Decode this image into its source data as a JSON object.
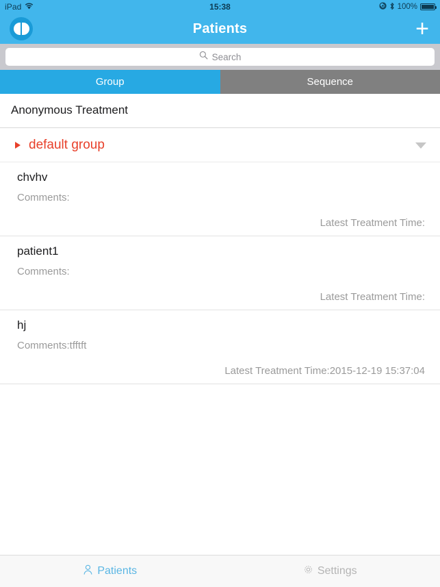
{
  "status_bar": {
    "carrier": "iPad",
    "wifi_icon": "wifi-icon",
    "time": "15:38",
    "rotation_lock_icon": "rotation-lock-icon",
    "bluetooth_icon": "bluetooth-icon",
    "battery_percent": "100%",
    "battery_icon": "battery-full-icon"
  },
  "navbar": {
    "logo_icon": "app-logo-icon",
    "title": "Patients",
    "add_label": "+",
    "add_icon": "plus-icon",
    "background_color": "#41b6ec"
  },
  "search": {
    "placeholder": "Search",
    "value": "",
    "icon": "search-icon"
  },
  "segmented": {
    "tabs": [
      {
        "label": "Group",
        "active": true,
        "color": "#27a9e3"
      },
      {
        "label": "Sequence",
        "active": false,
        "color": "#808080"
      }
    ]
  },
  "main": {
    "section_title": "Anonymous Treatment",
    "group": {
      "name": "default group",
      "color": "#e8402a",
      "expand_icon": "triangle-right-icon",
      "collapse_icon": "triangle-down-icon"
    },
    "patients": [
      {
        "name": "chvhv",
        "comments": "Comments:",
        "latest_treatment_time": "Latest Treatment Time:"
      },
      {
        "name": "patient1",
        "comments": "Comments:",
        "latest_treatment_time": "Latest Treatment Time:"
      },
      {
        "name": "hj",
        "comments": "Comments:tfftft",
        "latest_treatment_time": "Latest Treatment Time:2015-12-19 15:37:04"
      }
    ]
  },
  "tabbar": {
    "items": [
      {
        "label": "Patients",
        "icon": "person-icon",
        "active": true,
        "color": "#5ab6e4"
      },
      {
        "label": "Settings",
        "icon": "gear-icon",
        "active": false,
        "color": "#b4b4b4"
      }
    ]
  }
}
